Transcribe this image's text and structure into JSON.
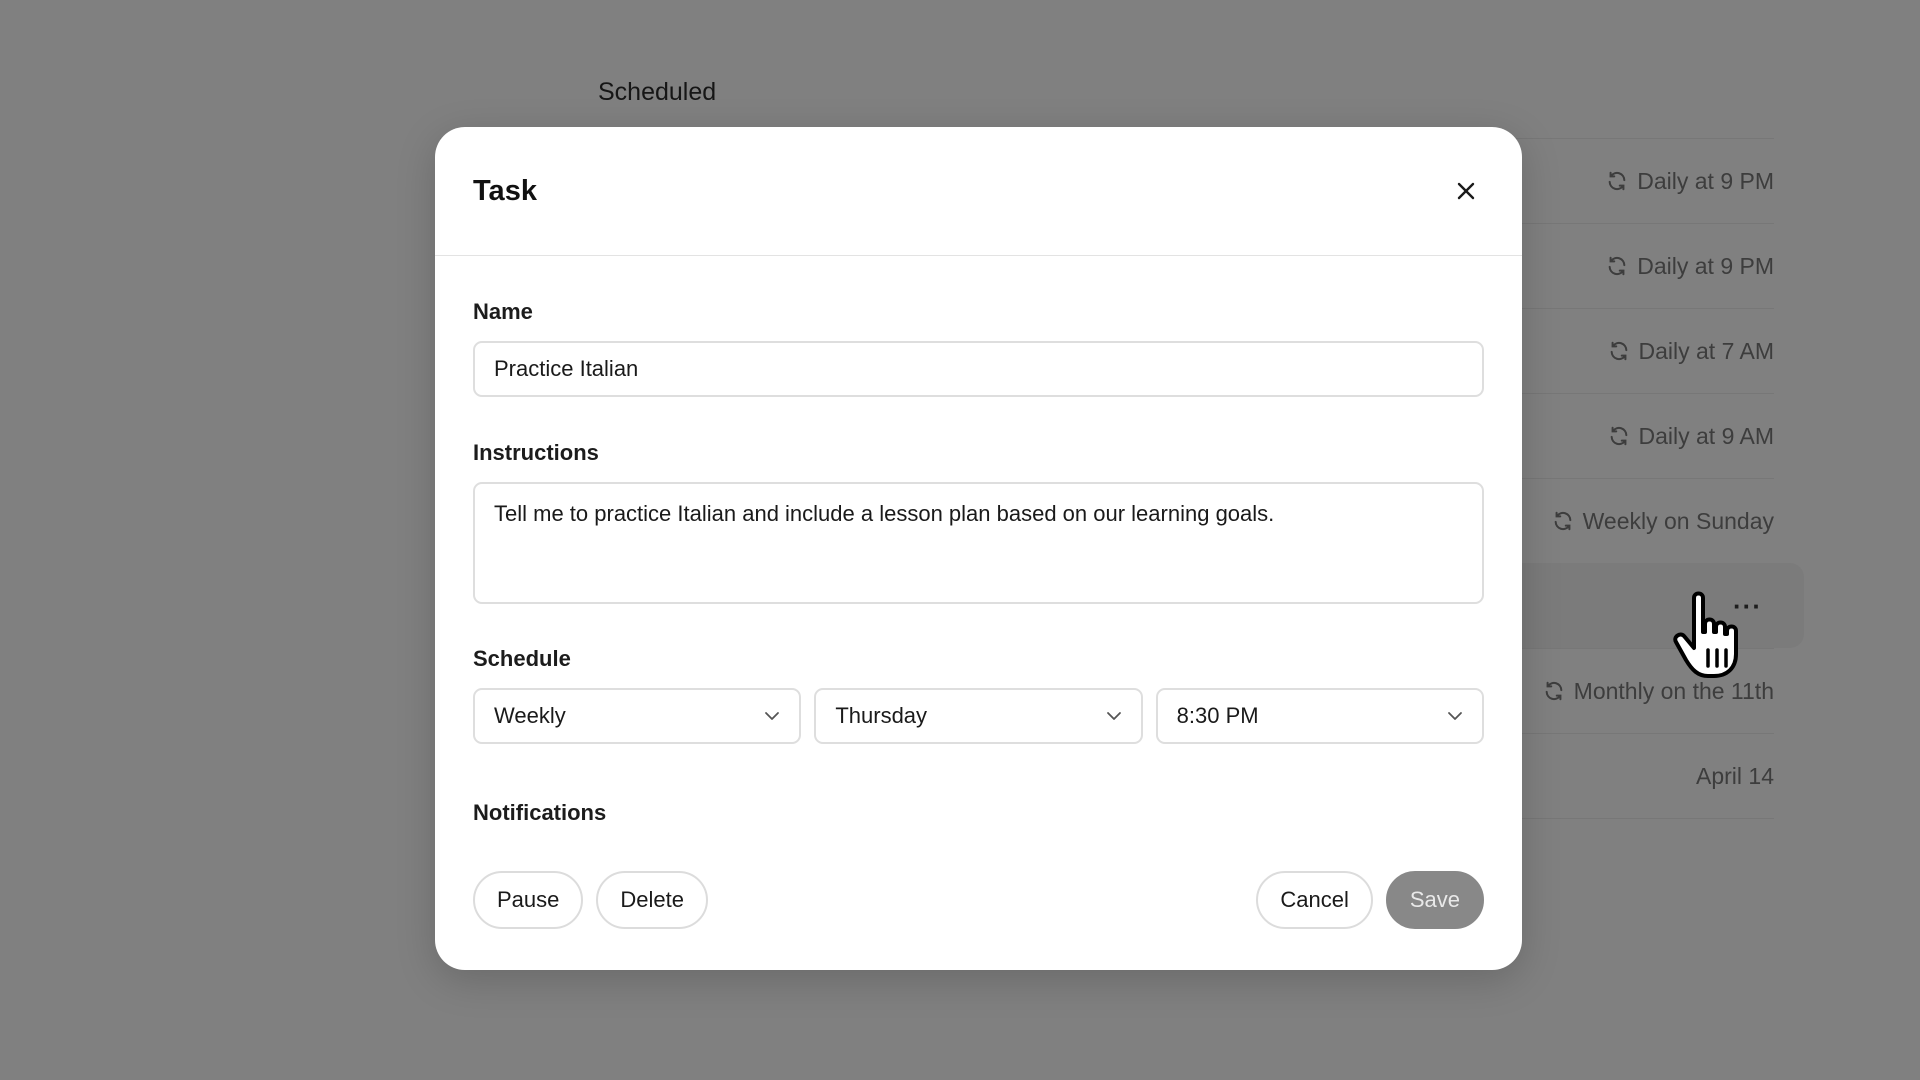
{
  "background": {
    "title": "Scheduled",
    "rows": [
      {
        "schedule": "Daily at 9 PM"
      },
      {
        "schedule": "Daily at 9 PM"
      },
      {
        "schedule": "Daily at 7 AM"
      },
      {
        "schedule": "Daily at 9 AM"
      },
      {
        "schedule": "Weekly on Sunday"
      },
      {
        "schedule": "",
        "more": "···"
      },
      {
        "schedule": "Monthly on the 11th"
      },
      {
        "schedule": "April 14"
      }
    ]
  },
  "modal": {
    "title": "Task",
    "close_icon": "close-icon",
    "name_label": "Name",
    "name_value": "Practice Italian",
    "instructions_label": "Instructions",
    "instructions_value": "Tell me to practice Italian and include a lesson plan based on our learning goals.",
    "schedule_label": "Schedule",
    "frequency": "Weekly",
    "day": "Thursday",
    "time": "8:30 PM",
    "notifications_label": "Notifications",
    "pause_label": "Pause",
    "delete_label": "Delete",
    "cancel_label": "Cancel",
    "save_label": "Save"
  },
  "colors": {
    "overlay": "#808080",
    "modal_bg": "#ffffff",
    "save_disabled": "#888888"
  }
}
